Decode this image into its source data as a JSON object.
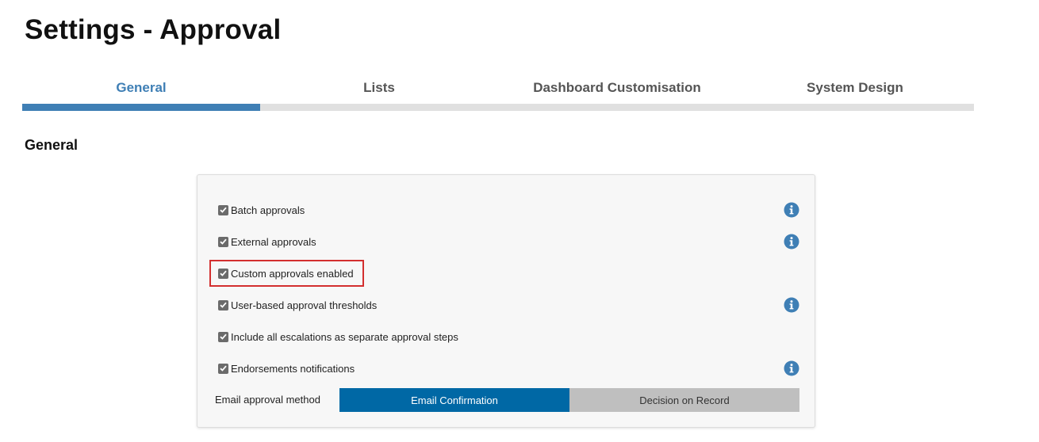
{
  "page": {
    "title": "Settings - Approval"
  },
  "tabs": [
    {
      "label": "General",
      "active": true
    },
    {
      "label": "Lists",
      "active": false
    },
    {
      "label": "Dashboard Customisation",
      "active": false
    },
    {
      "label": "System Design",
      "active": false
    }
  ],
  "section": {
    "heading": "General"
  },
  "options": [
    {
      "label": "Batch approvals",
      "checked": true,
      "info_icon": true
    },
    {
      "label": "External approvals",
      "checked": true,
      "info_icon": true
    },
    {
      "label": "Custom approvals enabled",
      "checked": true,
      "info_icon": false,
      "highlighted": true
    },
    {
      "label": "User-based approval thresholds",
      "checked": true,
      "info_icon": true
    },
    {
      "label": "Include all escalations as separate approval steps",
      "checked": true,
      "info_icon": false
    },
    {
      "label": "Endorsements notifications",
      "checked": true,
      "info_icon": true
    }
  ],
  "email_method": {
    "label": "Email approval method",
    "options": [
      {
        "label": "Email Confirmation",
        "selected": true
      },
      {
        "label": "Decision on Record",
        "selected": false
      }
    ]
  },
  "colors": {
    "accent": "#3f7fb5",
    "primary_button": "#0068a5",
    "secondary_button": "#bfbfbf",
    "highlight": "#d32f2f",
    "tab_inactive": "#e0e0e0"
  }
}
